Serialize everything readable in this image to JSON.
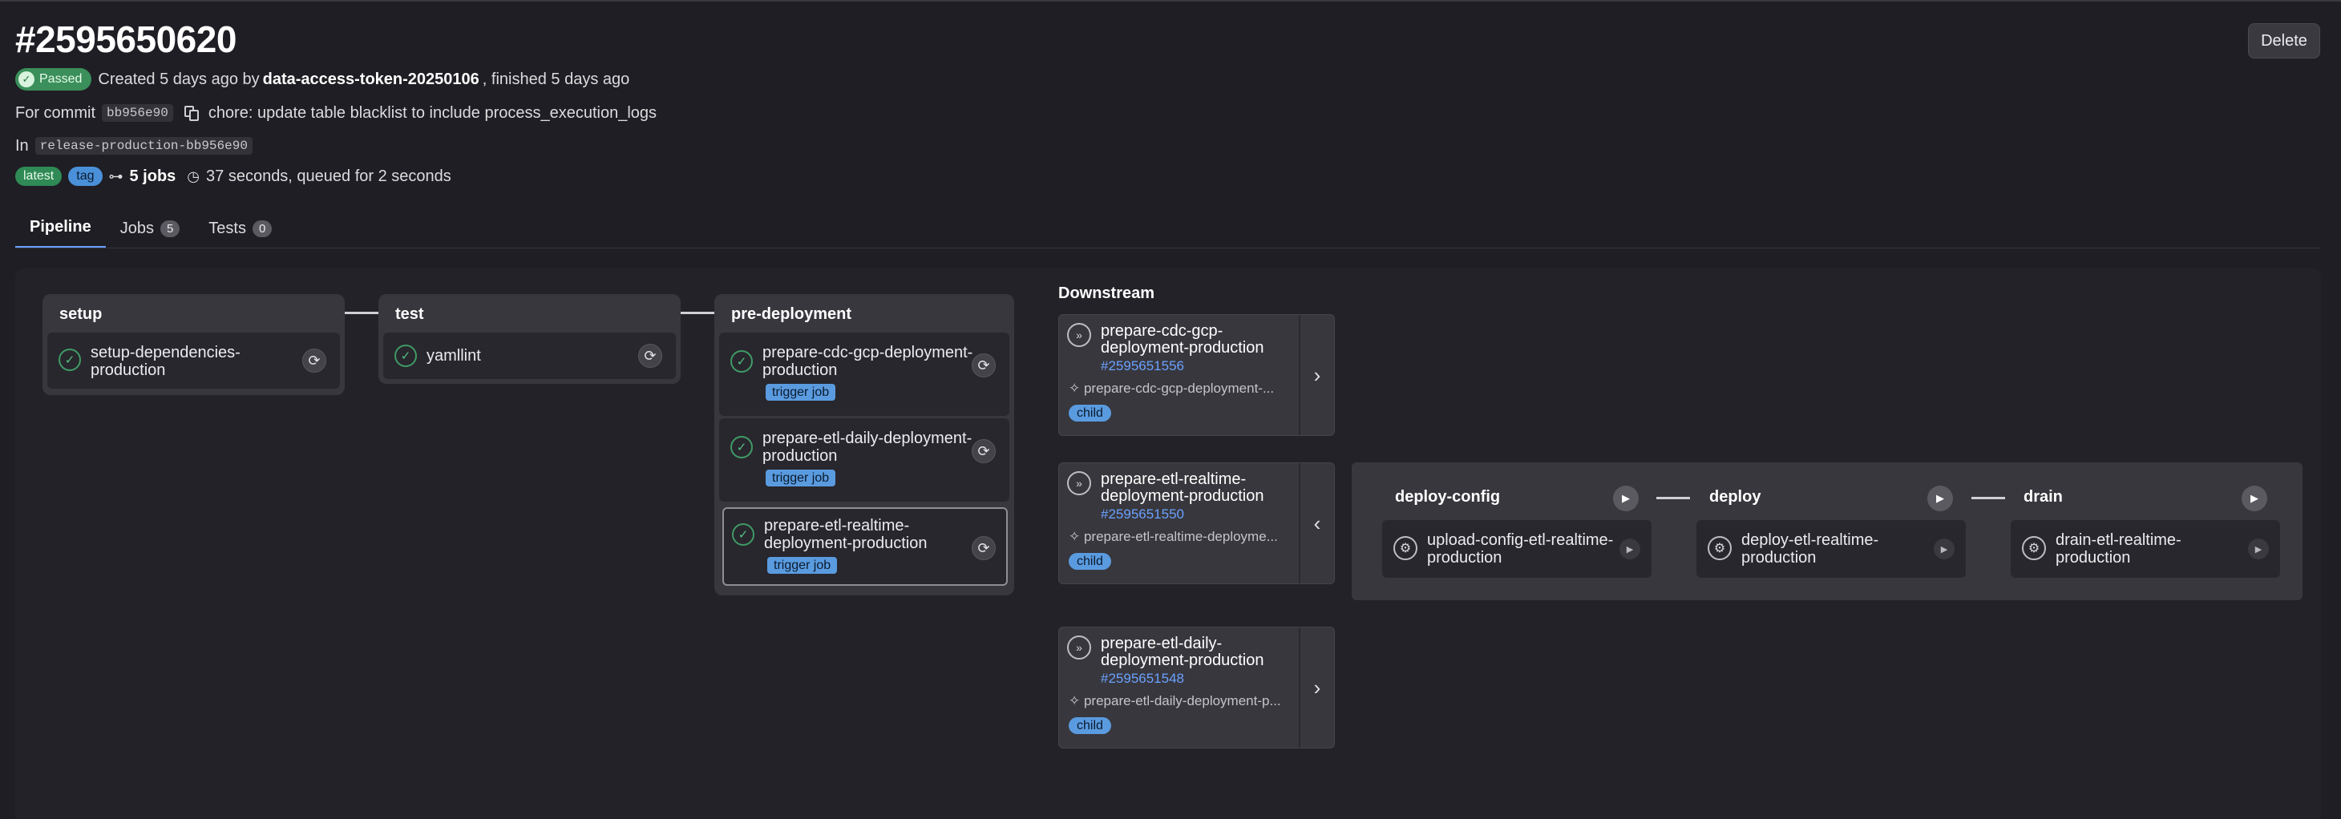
{
  "pipeline": {
    "title": "#2595650620",
    "delete_label": "Delete",
    "status_label": "Passed",
    "created_prefix": "Created 5 days ago by",
    "author": "data-access-token-20250106",
    "finished_text": ", finished 5 days ago",
    "commit_prefix": "For commit",
    "commit_sha": "bb956e90",
    "commit_message": "chore: update table blacklist to include process_execution_logs",
    "ref_prefix": "In",
    "ref_name": "release-production-bb956e90",
    "tag_latest": "latest",
    "tag_tag": "tag",
    "jobs_count_text": "5 jobs",
    "duration_text": "37 seconds, queued for 2 seconds"
  },
  "tabs": [
    {
      "label": "Pipeline",
      "count": null
    },
    {
      "label": "Jobs",
      "count": "5"
    },
    {
      "label": "Tests",
      "count": "0"
    }
  ],
  "stages": [
    {
      "name": "setup",
      "jobs": [
        {
          "name": "setup-dependencies-production",
          "line1": "setup-dependencies-",
          "line2": "production"
        }
      ]
    },
    {
      "name": "test",
      "jobs": [
        {
          "name": "yamllint"
        }
      ]
    },
    {
      "name": "pre-deployment",
      "jobs": [
        {
          "line1": "prepare-cdc-gcp-deployment-",
          "line2": "production",
          "badge": "trigger job"
        },
        {
          "line1": "prepare-etl-daily-deployment-",
          "line2": "production",
          "badge": "trigger job"
        },
        {
          "line1": "prepare-etl-realtime-",
          "line2": "deployment-production",
          "badge": "trigger job"
        }
      ]
    }
  ],
  "downstream": {
    "title": "Downstream",
    "cards": [
      {
        "line1": "prepare-cdc-gcp-",
        "line2": "deployment-production",
        "id": "#2595651556",
        "source": "prepare-cdc-gcp-deployment-...",
        "badge": "child",
        "arrow": "›"
      },
      {
        "line1": "prepare-etl-realtime-",
        "line2": "deployment-production",
        "id": "#2595651550",
        "source": "prepare-etl-realtime-deployme...",
        "badge": "child",
        "arrow": "‹"
      },
      {
        "line1": "prepare-etl-daily-",
        "line2": "deployment-production",
        "id": "#2595651548",
        "source": "prepare-etl-daily-deployment-p...",
        "badge": "child",
        "arrow": "›"
      }
    ]
  },
  "child_pipeline": {
    "stages": [
      {
        "name": "deploy-config",
        "job_line1": "upload-config-etl-realtime-",
        "job_line2": "production"
      },
      {
        "name": "deploy",
        "job_line1": "deploy-etl-realtime-",
        "job_line2": "production"
      },
      {
        "name": "drain",
        "job_line1": "drain-etl-realtime-",
        "job_line2": "production"
      }
    ]
  },
  "colors": {
    "background": "#1f1e24",
    "success": "#3a8f5a",
    "link_blue": "#6aa1ff",
    "badge_blue": "#5a9be0"
  },
  "icons": {
    "status_success": "check-circle-icon",
    "retry": "retry-icon",
    "downstream": "double-chevron-icon",
    "manual": "gear-icon",
    "play": "play-icon"
  }
}
